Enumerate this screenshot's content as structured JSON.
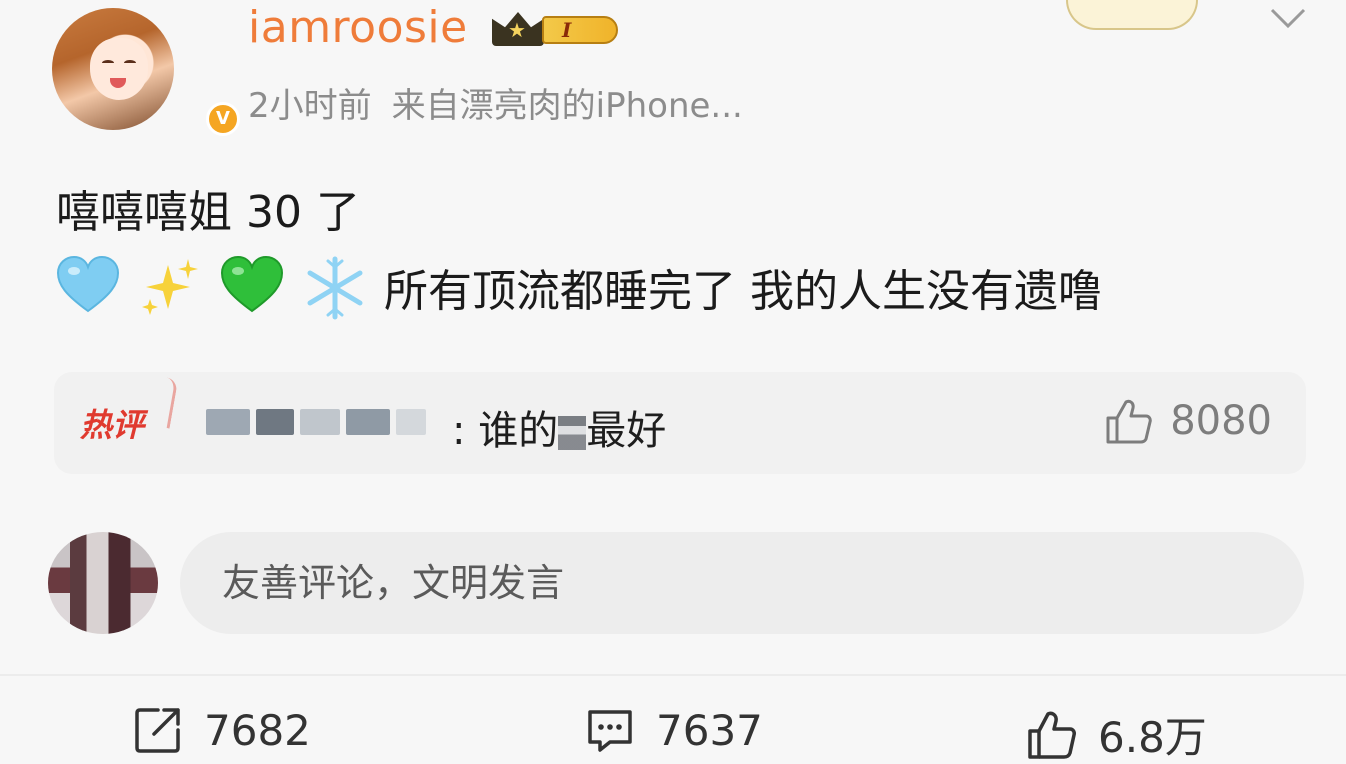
{
  "post": {
    "author": {
      "username": "iamroosie",
      "level_label": "I",
      "verified_badge": "V"
    },
    "meta": {
      "time": "2小时前",
      "source": "来自漂亮肉的iPhone..."
    },
    "text_line1": "嘻嘻嘻姐 30 了",
    "emojis": [
      "blue-heart",
      "sparkles",
      "green-heart",
      "snowflake"
    ],
    "text_line2": "所有顶流都睡完了 我的人生没有遗噜"
  },
  "hot_comment": {
    "tag": "热评",
    "text_prefix": ": 谁的",
    "text_suffix": "最好",
    "likes": "8080"
  },
  "comment_input": {
    "placeholder": "友善评论，文明发言"
  },
  "actions": {
    "repost_count": "7682",
    "comment_count": "7637",
    "like_count": "6.8万"
  },
  "colors": {
    "username": "#ef7c3a",
    "hot_tag": "#e03a2f",
    "muted": "#8c8c8c",
    "background": "#f7f7f7"
  }
}
